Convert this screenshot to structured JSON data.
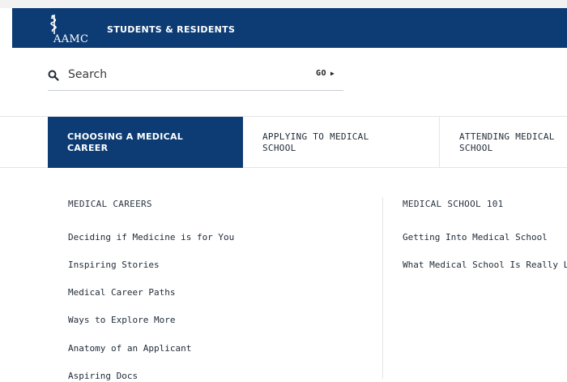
{
  "header": {
    "logo_text": "AAMC",
    "site_title": "STUDENTS & RESIDENTS"
  },
  "search": {
    "placeholder": "Search",
    "go_label": "GO"
  },
  "tabs": [
    {
      "line1": "CHOOSING A MEDICAL",
      "line2": "CAREER",
      "active": true
    },
    {
      "line1": "APPLYING TO MEDICAL",
      "line2": "SCHOOL",
      "active": false
    },
    {
      "line1": "ATTENDING MEDICAL",
      "line2": "SCHOOL",
      "active": false
    }
  ],
  "menu": {
    "left": {
      "heading": "MEDICAL CAREERS",
      "links": [
        "Deciding if Medicine is for You",
        "Inspiring Stories",
        "Medical Career Paths",
        "Ways to Explore More",
        "Anatomy of an Applicant",
        "Aspiring Docs"
      ]
    },
    "right": {
      "heading": "MEDICAL SCHOOL 101",
      "links": [
        "Getting Into Medical School",
        "What Medical School Is Really Like"
      ]
    }
  },
  "colors": {
    "brand": "#0d3c75"
  }
}
